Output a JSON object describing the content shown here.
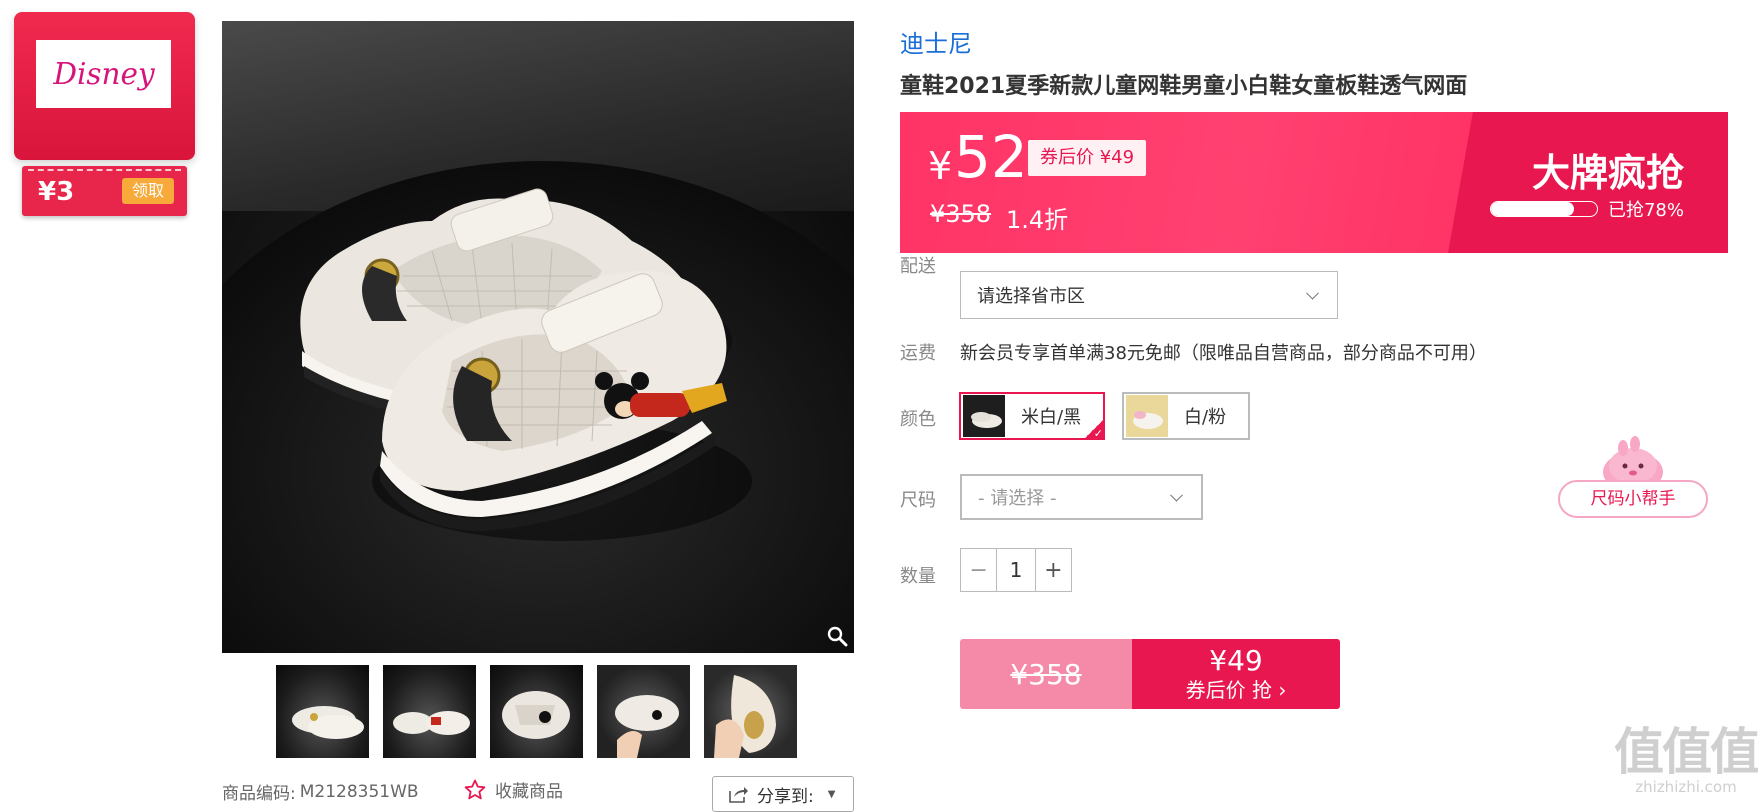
{
  "brand_card": {
    "logo_text": "Disney",
    "coupon_amount": "¥3",
    "claim_label": "领取"
  },
  "gallery": {
    "zoom_icon": "magnifier-icon",
    "thumbnail_count": 5
  },
  "meta": {
    "sku_label": "商品编码:",
    "sku_value": "M2128351WB",
    "favorite_label": "收藏商品",
    "share_label": "分享到:"
  },
  "product": {
    "brand": "迪士尼",
    "title": "童鞋2021夏季新款儿童网鞋男童小白鞋女童板鞋透气网面"
  },
  "price": {
    "currency": "¥",
    "current": "52",
    "coupon_price": "券后价 ¥49",
    "original": "¥358",
    "discount": "1.4折",
    "sale_title": "大牌疯抢",
    "sold_text": "已抢78%",
    "sold_fraction": 0.78
  },
  "delivery": {
    "label": "配送",
    "placeholder": "请选择省市区"
  },
  "shipping": {
    "label": "运费",
    "text": "新会员专享首单满38元免邮（限唯品自营商品，部分商品不可用）"
  },
  "color": {
    "label": "颜色",
    "options": [
      {
        "name": "米白/黑",
        "selected": true
      },
      {
        "name": "白/粉",
        "selected": false
      }
    ]
  },
  "size": {
    "label": "尺码",
    "placeholder": "- 请选择 -",
    "helper_label": "尺码小帮手"
  },
  "quantity": {
    "label": "数量",
    "value": "1",
    "minus": "−",
    "plus": "+"
  },
  "buy_button": {
    "original": "¥358",
    "price": "¥49",
    "label": "券后价 抢 ›"
  },
  "watermark": {
    "mark": "值值值",
    "site": "zhizhizhi.com"
  },
  "colors": {
    "accent": "#e8174f",
    "price_bg": "#ff3366",
    "brand_link": "#1a6ed8",
    "claim_orange": "#f7a93a"
  }
}
